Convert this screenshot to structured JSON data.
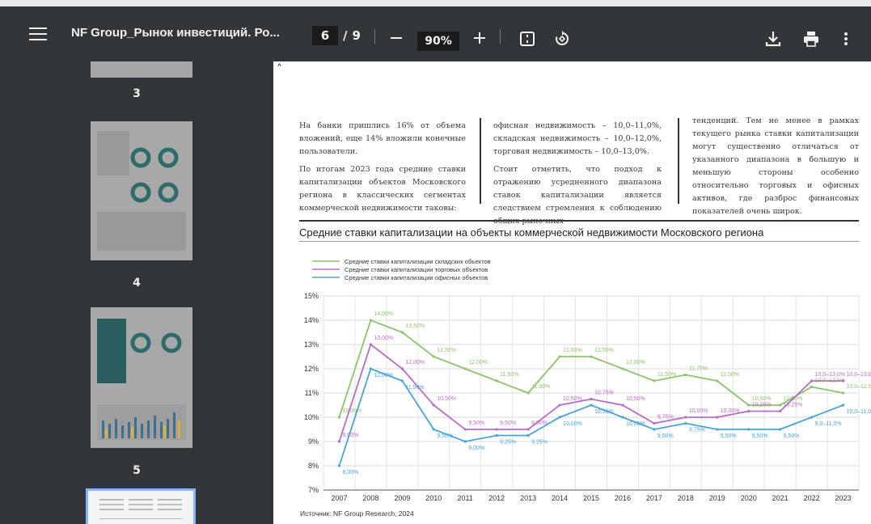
{
  "toolbar": {
    "title": "NF Group_Рынок инвестиций. Ро...",
    "page_current": "6",
    "page_total": "9",
    "page_sep": "/",
    "zoom": "90%"
  },
  "sidebar": {
    "thumbnails": [
      {
        "label": "3"
      },
      {
        "label": "4"
      },
      {
        "label": "5"
      },
      {
        "label": ""
      }
    ]
  },
  "document": {
    "col1": [
      "На банки пришлись 16% от объема вложений, еще 14% вложили конечные пользователи.",
      "По итогам 2023 года средние ставки капитализации объектов Московского региона в классических сегментах коммерческой недвижимости таковы:"
    ],
    "col2": [
      "офисная недвижимость – 10,0–11,0%, складская недвижимость – 10,0–12,0%, торговая недвижимость – 10,0–13,0%.",
      "Стоит отметить, что подход к отражению усредненного диапазона ставок капитализации является следствием стремления к соблюдению общих рыночных"
    ],
    "col3": [
      "тенденций. Тем не менее в рамках текущего рынка ставки капитализации могут существенно отличаться от указанного диапазона в большую и меньшую стороны особенно относительно торговых и офисных активов, где разброс финансовых показателей очень широк."
    ],
    "source": "Источник: NF Group Research, 2024"
  },
  "chart_data": {
    "type": "line",
    "title": "Средние ставки капитализации на объекты коммерческой недвижимости Московского региона",
    "x": [
      "2007",
      "2008",
      "2009",
      "2010",
      "2011",
      "2012",
      "2013",
      "2014",
      "2015",
      "2016",
      "2017",
      "2018",
      "2019",
      "2020",
      "2021",
      "2022",
      "2023"
    ],
    "ylim": [
      7,
      15
    ],
    "yticks": [
      "7%",
      "8%",
      "9%",
      "10%",
      "11%",
      "12%",
      "13%",
      "14%",
      "15%"
    ],
    "grid": true,
    "legend_position": "top-left",
    "series": [
      {
        "name": "Средние ставки капитализации складских объектов",
        "color": "#8dc26f",
        "values": [
          10.0,
          14.0,
          13.5,
          12.5,
          12.0,
          11.5,
          11.0,
          12.5,
          12.5,
          12.0,
          11.5,
          11.75,
          11.5,
          10.5,
          10.5,
          11.25,
          11.0
        ],
        "labels": [
          "10,00%",
          "14,00%",
          "13,50%",
          "12,50%",
          "12,00%",
          "11,50%",
          "11,00%",
          "12,50%",
          "12,50%",
          "12,00%",
          "11,50%",
          "11,75%",
          "11,50%",
          "10,50%",
          "10,50%",
          "10,0–12,5%",
          "10,0–12,0%"
        ]
      },
      {
        "name": "Средние ставки капитализации торговых объектов",
        "color": "#b56ec6",
        "values": [
          9.0,
          13.0,
          12.0,
          10.5,
          9.5,
          9.5,
          9.5,
          10.5,
          10.75,
          10.5,
          9.75,
          10.0,
          10.0,
          10.25,
          10.25,
          11.5,
          11.5
        ],
        "labels": [
          "9,00%",
          "13,00%",
          "12,00%",
          "10,50%",
          "9,50%",
          "9,50%",
          "9,50%",
          "10,50%",
          "10,75%",
          "10,50%",
          "9,75%",
          "10,00%",
          "10,00%",
          "10,25%",
          "10,25%",
          "10,0–13,0%",
          "10,0–13,0%"
        ]
      },
      {
        "name": "Средние ставки капитализации офисных объектов",
        "color": "#4aa3d8",
        "values": [
          8.0,
          12.0,
          11.5,
          9.5,
          9.0,
          9.25,
          9.25,
          10.0,
          10.5,
          10.0,
          9.5,
          9.75,
          9.5,
          9.5,
          9.5,
          10.0,
          10.5
        ],
        "labels": [
          "8,00%",
          "12,00%",
          "11,50%",
          "9,50%",
          "9,00%",
          "9,25%",
          "9,25%",
          "10,00%",
          "10,50%",
          "10,00%",
          "9,50%",
          "9,75%",
          "9,50%",
          "9,50%",
          "9,50%",
          "9,0–11,0%",
          "10,0–11,0%"
        ]
      }
    ]
  },
  "colors": {
    "toolbar_bg": "#323639",
    "sidebar_bg": "#323639",
    "accent": "#8ab4f8"
  },
  "icons": [
    "menu-icon",
    "zoom-out-icon",
    "zoom-in-icon",
    "fit-page-icon",
    "rotate-icon",
    "download-icon",
    "print-icon",
    "more-icon"
  ]
}
